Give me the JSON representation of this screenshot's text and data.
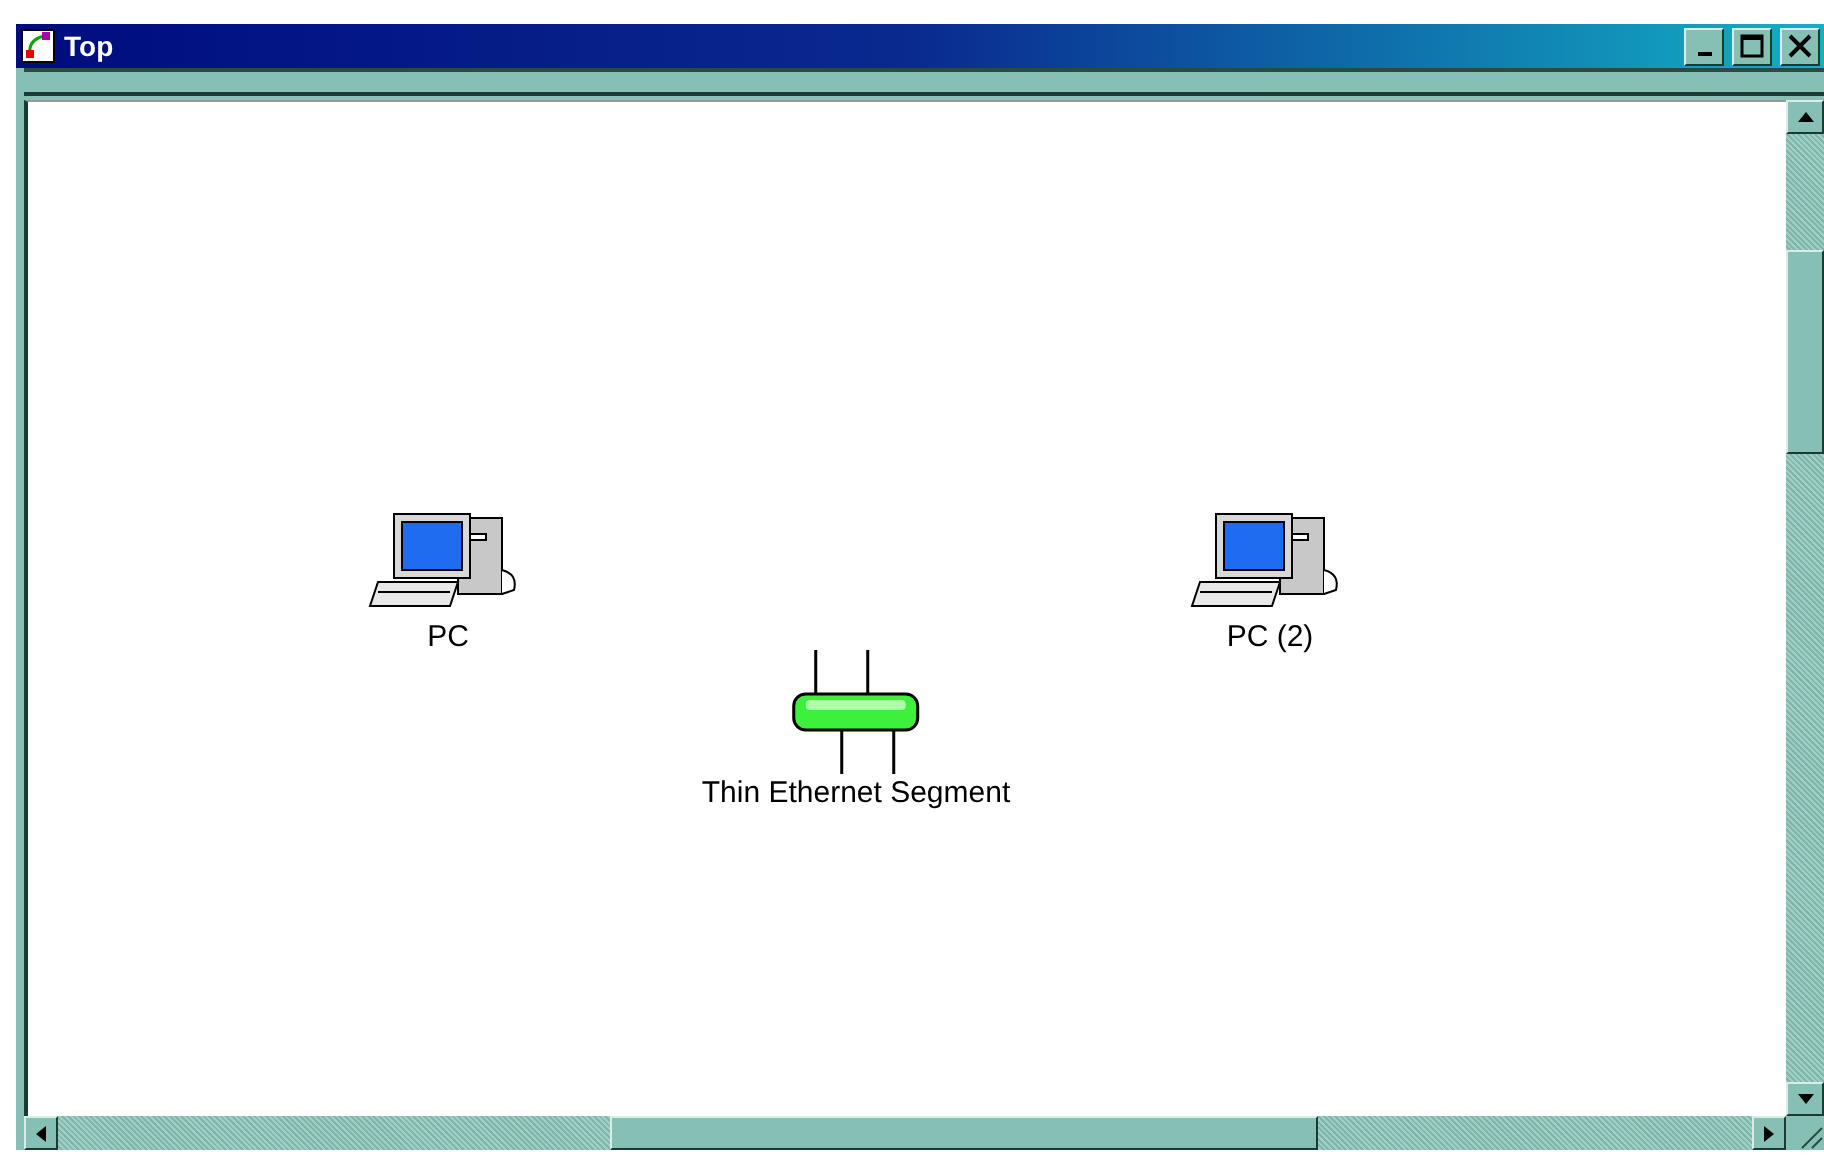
{
  "window": {
    "title": "Top"
  },
  "nodes": [
    {
      "kind": "pc",
      "label": "PC"
    },
    {
      "kind": "pc",
      "label": "PC (2)"
    },
    {
      "kind": "segment",
      "label": "Thin Ethernet Segment"
    }
  ]
}
